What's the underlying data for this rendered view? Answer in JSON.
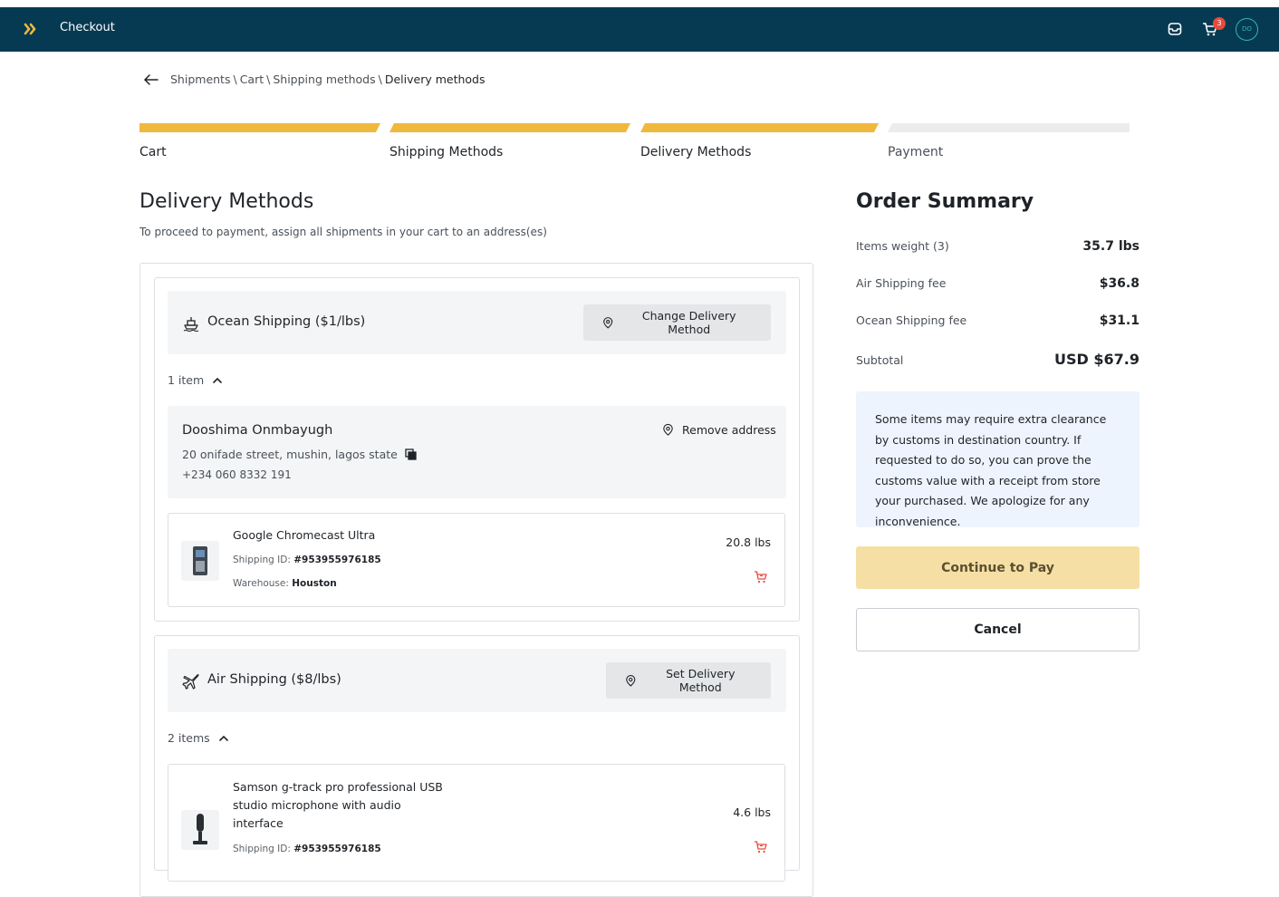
{
  "header": {
    "app_title": "Checkout",
    "cart_count": "3",
    "avatar_initials": "DO",
    "logo_icon": "double-chevron-right-icon",
    "inbox_icon": "inbox-icon",
    "cart_icon": "cart-icon"
  },
  "breadcrumb": {
    "items": [
      "Shipments",
      "Cart",
      "Shipping methods",
      "Delivery methods"
    ],
    "separator": "\\"
  },
  "stepper": {
    "steps": [
      {
        "label": "Cart",
        "complete": true
      },
      {
        "label": "Shipping Methods",
        "complete": true
      },
      {
        "label": "Delivery Methods",
        "complete": true
      },
      {
        "label": "Payment",
        "complete": false
      }
    ],
    "complete_color": "#f0b93d",
    "incomplete_color": "#ebecee"
  },
  "main": {
    "title": "Delivery Methods",
    "subtitle": "To proceed to payment, assign all shipments in your cart to an address(es)",
    "groups": [
      {
        "title": "Ocean Shipping ($1/lbs)",
        "icon": "ship-icon",
        "button_label": "Change Delivery Method",
        "count_label": "1 item",
        "address": {
          "name": "Dooshima Onmbayugh",
          "street": "20 onifade street, mushin, lagos state",
          "phone": "+234 060 8332 191",
          "remove_label": "Remove address"
        },
        "items": [
          {
            "name": "Google Chromecast Ultra",
            "shipping_id_label": "Shipping ID:",
            "shipping_id": "#953955976185",
            "warehouse_label": "Warehouse:",
            "warehouse": "Houston",
            "weight": "20.8 lbs"
          }
        ]
      },
      {
        "title": "Air Shipping ($8/lbs)",
        "icon": "plane-icon",
        "button_label": "Set Delivery Method",
        "count_label": "2 items",
        "items": [
          {
            "name_lines": [
              "Samson g-track pro professional USB",
              "studio microphone with audio",
              "interface"
            ],
            "shipping_id_label": "Shipping ID:",
            "shipping_id": "#953955976185",
            "weight": "4.6 lbs"
          }
        ]
      }
    ]
  },
  "summary": {
    "title": "Order Summary",
    "rows": [
      {
        "label": "Items weight (3)",
        "value": "35.7 lbs"
      },
      {
        "label": "Air Shipping fee",
        "value": "$36.8"
      },
      {
        "label": "Ocean Shipping fee",
        "value": "$31.1"
      },
      {
        "label": "Subtotal",
        "value": "USD $67.9"
      }
    ],
    "notice": "Some items may require extra clearance by customs in destination country. If requested to do so, you can prove the customs value with a receipt from store your purchased. We apologize for any inconvenience.",
    "pay_label": "Continue to Pay",
    "cancel_label": "Cancel"
  }
}
